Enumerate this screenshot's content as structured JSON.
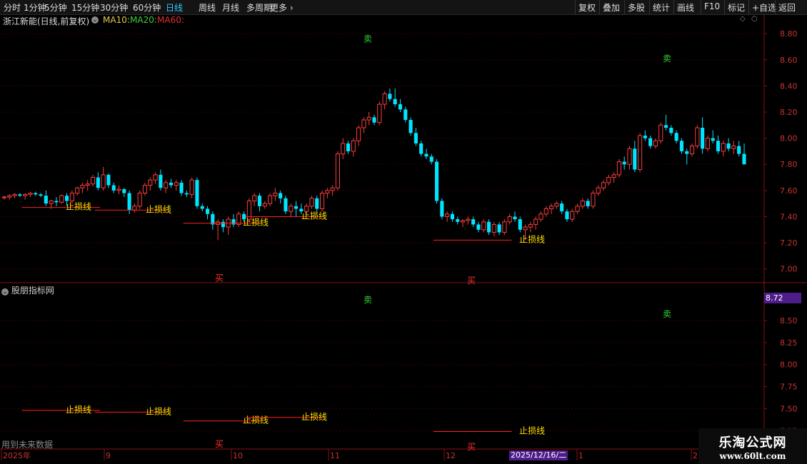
{
  "toolbar": {
    "periods": [
      "分时",
      "1分钟",
      "5分钟",
      "15分钟",
      "30分钟",
      "60分钟",
      "日线",
      "周线",
      "月线",
      "多周期",
      "更多"
    ],
    "active_period": "日线",
    "right_buttons": [
      "复权",
      "叠加",
      "多股",
      "统计",
      "画线",
      "F10",
      "标记",
      "+自选",
      "返回"
    ]
  },
  "header": {
    "stock_title": "浙江新能(日线,前复权)",
    "ma10_label": "MA10:",
    "ma20_label": "MA20:",
    "ma60_label": "MA60:",
    "ma10_color": "#e6c84a",
    "ma20_color": "#3ad23a",
    "ma60_color": "#e03030"
  },
  "indicator": {
    "title": "股朋指标网",
    "price_badge": "8.72",
    "future_note": "用到未来数据"
  },
  "signals": {
    "sell_label": "卖",
    "buy_label": "买",
    "stop_label": "止损线"
  },
  "time_axis": {
    "labels": [
      "2025年",
      "9",
      "10",
      "11",
      "12",
      "2025/12/16/二",
      "1",
      "2"
    ],
    "highlight": "2025/12/16/二"
  },
  "watermark": {
    "line1": "乐淘公式网",
    "line2": "www.60lt.com"
  },
  "colors": {
    "up": "#ff3c3c",
    "down": "#00e5ff",
    "stop_line": "#ff2020",
    "stop_text": "#ffe000",
    "sell": "#2fd52f",
    "buy": "#ff3030",
    "grid": "#3a0000",
    "axis": "#8a1010"
  },
  "chart_data": [
    {
      "type": "candlestick",
      "title": "浙江新能(日线,前复权)",
      "y_ticks": [
        8.8,
        8.6,
        8.4,
        8.2,
        8.0,
        7.8,
        7.6,
        7.4,
        7.2,
        7.0
      ],
      "ylim": [
        6.9,
        8.85
      ],
      "candles": [
        [
          7.55,
          7.56,
          7.53,
          7.55
        ],
        [
          7.55,
          7.57,
          7.53,
          7.56
        ],
        [
          7.56,
          7.58,
          7.54,
          7.57
        ],
        [
          7.57,
          7.58,
          7.55,
          7.56
        ],
        [
          7.56,
          7.58,
          7.53,
          7.57
        ],
        [
          7.57,
          7.59,
          7.55,
          7.58
        ],
        [
          7.58,
          7.59,
          7.56,
          7.57
        ],
        [
          7.57,
          7.58,
          7.55,
          7.56
        ],
        [
          7.56,
          7.6,
          7.48,
          7.5
        ],
        [
          7.5,
          7.53,
          7.46,
          7.52
        ],
        [
          7.52,
          7.55,
          7.48,
          7.51
        ],
        [
          7.51,
          7.57,
          7.5,
          7.56
        ],
        [
          7.56,
          7.58,
          7.48,
          7.52
        ],
        [
          7.52,
          7.6,
          7.5,
          7.58
        ],
        [
          7.58,
          7.63,
          7.56,
          7.62
        ],
        [
          7.62,
          7.66,
          7.58,
          7.64
        ],
        [
          7.64,
          7.68,
          7.6,
          7.65
        ],
        [
          7.65,
          7.72,
          7.63,
          7.7
        ],
        [
          7.7,
          7.74,
          7.6,
          7.62
        ],
        [
          7.62,
          7.78,
          7.6,
          7.72
        ],
        [
          7.72,
          7.73,
          7.62,
          7.64
        ],
        [
          7.64,
          7.66,
          7.58,
          7.6
        ],
        [
          7.6,
          7.64,
          7.57,
          7.61
        ],
        [
          7.61,
          7.62,
          7.55,
          7.58
        ],
        [
          7.58,
          7.6,
          7.42,
          7.45
        ],
        [
          7.45,
          7.5,
          7.43,
          7.48
        ],
        [
          7.48,
          7.6,
          7.46,
          7.58
        ],
        [
          7.58,
          7.66,
          7.56,
          7.64
        ],
        [
          7.64,
          7.7,
          7.6,
          7.68
        ],
        [
          7.68,
          7.74,
          7.65,
          7.72
        ],
        [
          7.72,
          7.76,
          7.6,
          7.62
        ],
        [
          7.62,
          7.68,
          7.58,
          7.66
        ],
        [
          7.66,
          7.69,
          7.62,
          7.64
        ],
        [
          7.64,
          7.68,
          7.6,
          7.66
        ],
        [
          7.66,
          7.68,
          7.56,
          7.58
        ],
        [
          7.58,
          7.6,
          7.55,
          7.57
        ],
        [
          7.57,
          7.7,
          7.54,
          7.68
        ],
        [
          7.68,
          7.7,
          7.46,
          7.48
        ],
        [
          7.48,
          7.5,
          7.44,
          7.46
        ],
        [
          7.46,
          7.48,
          7.38,
          7.42
        ],
        [
          7.42,
          7.44,
          7.3,
          7.34
        ],
        [
          7.34,
          7.38,
          7.22,
          7.36
        ],
        [
          7.36,
          7.38,
          7.28,
          7.32
        ],
        [
          7.32,
          7.4,
          7.26,
          7.38
        ],
        [
          7.38,
          7.42,
          7.32,
          7.34
        ],
        [
          7.34,
          7.44,
          7.32,
          7.42
        ],
        [
          7.42,
          7.44,
          7.36,
          7.38
        ],
        [
          7.38,
          7.54,
          7.36,
          7.52
        ],
        [
          7.52,
          7.58,
          7.48,
          7.56
        ],
        [
          7.56,
          7.58,
          7.44,
          7.48
        ],
        [
          7.48,
          7.52,
          7.46,
          7.5
        ],
        [
          7.5,
          7.58,
          7.48,
          7.56
        ],
        [
          7.56,
          7.62,
          7.52,
          7.58
        ],
        [
          7.58,
          7.6,
          7.5,
          7.54
        ],
        [
          7.54,
          7.56,
          7.42,
          7.44
        ],
        [
          7.44,
          7.5,
          7.4,
          7.48
        ],
        [
          7.48,
          7.52,
          7.4,
          7.46
        ],
        [
          7.46,
          7.5,
          7.42,
          7.44
        ],
        [
          7.44,
          7.5,
          7.42,
          7.48
        ],
        [
          7.48,
          7.56,
          7.46,
          7.54
        ],
        [
          7.54,
          7.56,
          7.44,
          7.46
        ],
        [
          7.46,
          7.6,
          7.44,
          7.58
        ],
        [
          7.58,
          7.62,
          7.54,
          7.6
        ],
        [
          7.6,
          7.64,
          7.56,
          7.62
        ],
        [
          7.62,
          7.9,
          7.6,
          7.88
        ],
        [
          7.88,
          8.0,
          7.84,
          7.96
        ],
        [
          7.96,
          7.98,
          7.88,
          7.9
        ],
        [
          7.9,
          8.0,
          7.86,
          7.98
        ],
        [
          7.98,
          8.1,
          7.94,
          8.08
        ],
        [
          8.08,
          8.16,
          8.04,
          8.14
        ],
        [
          8.14,
          8.2,
          8.1,
          8.16
        ],
        [
          8.16,
          8.18,
          8.1,
          8.12
        ],
        [
          8.12,
          8.28,
          8.1,
          8.26
        ],
        [
          8.26,
          8.36,
          8.22,
          8.34
        ],
        [
          8.34,
          8.38,
          8.28,
          8.3
        ],
        [
          8.3,
          8.38,
          8.24,
          8.26
        ],
        [
          8.26,
          8.3,
          8.2,
          8.22
        ],
        [
          8.22,
          8.24,
          8.12,
          8.14
        ],
        [
          8.14,
          8.16,
          8.02,
          8.04
        ],
        [
          8.04,
          8.08,
          7.94,
          7.96
        ],
        [
          7.96,
          7.98,
          7.86,
          7.88
        ],
        [
          7.88,
          7.92,
          7.84,
          7.86
        ],
        [
          7.86,
          7.88,
          7.8,
          7.82
        ],
        [
          7.82,
          7.84,
          7.5,
          7.52
        ],
        [
          7.52,
          7.54,
          7.38,
          7.4
        ],
        [
          7.4,
          7.44,
          7.36,
          7.42
        ],
        [
          7.42,
          7.44,
          7.36,
          7.38
        ],
        [
          7.38,
          7.4,
          7.34,
          7.36
        ],
        [
          7.36,
          7.38,
          7.32,
          7.37
        ],
        [
          7.37,
          7.4,
          7.34,
          7.38
        ],
        [
          7.38,
          7.4,
          7.32,
          7.34
        ],
        [
          7.34,
          7.36,
          7.28,
          7.3
        ],
        [
          7.3,
          7.38,
          7.28,
          7.36
        ],
        [
          7.36,
          7.38,
          7.26,
          7.28
        ],
        [
          7.28,
          7.36,
          7.25,
          7.34
        ],
        [
          7.34,
          7.36,
          7.26,
          7.28
        ],
        [
          7.28,
          7.38,
          7.26,
          7.36
        ],
        [
          7.36,
          7.42,
          7.34,
          7.4
        ],
        [
          7.4,
          7.44,
          7.36,
          7.38
        ],
        [
          7.38,
          7.4,
          7.28,
          7.3
        ],
        [
          7.3,
          7.34,
          7.22,
          7.32
        ],
        [
          7.32,
          7.36,
          7.28,
          7.34
        ],
        [
          7.34,
          7.4,
          7.3,
          7.38
        ],
        [
          7.38,
          7.44,
          7.36,
          7.42
        ],
        [
          7.42,
          7.48,
          7.4,
          7.46
        ],
        [
          7.46,
          7.5,
          7.42,
          7.48
        ],
        [
          7.48,
          7.52,
          7.46,
          7.5
        ],
        [
          7.5,
          7.52,
          7.42,
          7.44
        ],
        [
          7.44,
          7.46,
          7.36,
          7.38
        ],
        [
          7.38,
          7.46,
          7.36,
          7.44
        ],
        [
          7.44,
          7.5,
          7.42,
          7.48
        ],
        [
          7.48,
          7.54,
          7.46,
          7.52
        ],
        [
          7.52,
          7.54,
          7.46,
          7.48
        ],
        [
          7.48,
          7.6,
          7.46,
          7.58
        ],
        [
          7.58,
          7.64,
          7.56,
          7.62
        ],
        [
          7.62,
          7.68,
          7.6,
          7.66
        ],
        [
          7.66,
          7.72,
          7.64,
          7.7
        ],
        [
          7.7,
          7.74,
          7.66,
          7.72
        ],
        [
          7.72,
          7.84,
          7.7,
          7.82
        ],
        [
          7.82,
          7.86,
          7.76,
          7.8
        ],
        [
          7.8,
          7.94,
          7.76,
          7.92
        ],
        [
          7.92,
          7.98,
          7.74,
          7.76
        ],
        [
          7.76,
          8.04,
          7.74,
          8.02
        ],
        [
          8.02,
          8.06,
          7.98,
          8.0
        ],
        [
          8.0,
          8.02,
          7.92,
          7.94
        ],
        [
          7.94,
          8.0,
          7.92,
          7.98
        ],
        [
          7.98,
          8.12,
          7.96,
          8.1
        ],
        [
          8.1,
          8.18,
          8.06,
          8.08
        ],
        [
          8.08,
          8.1,
          8.02,
          8.04
        ],
        [
          8.04,
          8.06,
          7.96,
          7.98
        ],
        [
          7.98,
          8.0,
          7.88,
          7.9
        ],
        [
          7.9,
          7.92,
          7.8,
          7.88
        ],
        [
          7.88,
          7.96,
          7.86,
          7.94
        ],
        [
          7.94,
          8.1,
          7.92,
          8.08
        ],
        [
          8.08,
          8.16,
          7.88,
          7.92
        ],
        [
          7.92,
          8.02,
          7.9,
          8.0
        ],
        [
          8.0,
          8.06,
          7.96,
          7.98
        ],
        [
          7.98,
          8.02,
          7.88,
          7.9
        ],
        [
          7.9,
          7.98,
          7.86,
          7.96
        ],
        [
          7.96,
          8.0,
          7.9,
          7.92
        ],
        [
          7.92,
          7.98,
          7.88,
          7.94
        ],
        [
          7.94,
          7.98,
          7.86,
          7.88
        ],
        [
          7.88,
          7.96,
          7.8,
          7.8
        ]
      ],
      "sell_signals_at_price": [
        8.76,
        8.61
      ],
      "buy_signals_at_price": [
        6.93,
        6.91
      ],
      "stop_lines": [
        7.47,
        7.45,
        7.35,
        7.4,
        7.22
      ]
    },
    {
      "type": "indicator",
      "title": "股朋指标网",
      "y_ticks": [
        8.5,
        8.25,
        8.0,
        7.75,
        7.5,
        7.25
      ],
      "ylim": [
        7.05,
        8.8
      ],
      "stop_lines": [
        7.48,
        7.46,
        7.36,
        7.4,
        7.24
      ]
    }
  ]
}
